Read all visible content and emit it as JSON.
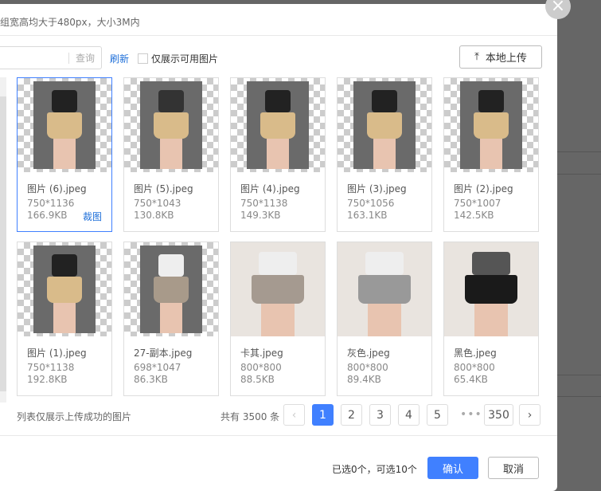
{
  "header": {
    "hint": "组宽高均大于480px，大小3M内"
  },
  "toolbar": {
    "search_button": "查询",
    "refresh": "刷新",
    "only_available": "仅展示可用图片",
    "upload": "本地上传"
  },
  "images": [
    {
      "name": "图片 (6).jpeg",
      "dim": "750*1136",
      "size": "166.9KB",
      "crop": "裁图",
      "selected": true,
      "top": "#222",
      "short": "#d9bb8a",
      "full": false
    },
    {
      "name": "图片 (5).jpeg",
      "dim": "750*1043",
      "size": "130.8KB",
      "top": "#333",
      "short": "#d9bb8a",
      "full": false
    },
    {
      "name": "图片 (4).jpeg",
      "dim": "750*1138",
      "size": "149.3KB",
      "top": "#222",
      "short": "#d9bb8a",
      "full": false
    },
    {
      "name": "图片 (3).jpeg",
      "dim": "750*1056",
      "size": "163.1KB",
      "top": "#222",
      "short": "#d9bb8a",
      "full": false
    },
    {
      "name": "图片 (2).jpeg",
      "dim": "750*1007",
      "size": "142.5KB",
      "top": "#222",
      "short": "#d9bb8a",
      "full": false
    },
    {
      "name": "图片 (1).jpeg",
      "dim": "750*1138",
      "size": "192.8KB",
      "top": "#222",
      "short": "#d9bb8a",
      "full": false
    },
    {
      "name": "27-副本.jpeg",
      "dim": "698*1047",
      "size": "86.3KB",
      "top": "#eee",
      "short": "#a89a8a",
      "full": false
    },
    {
      "name": "卡其.jpeg",
      "dim": "800*800",
      "size": "88.5KB",
      "top": "#eee",
      "short": "#a59a90",
      "full": true
    },
    {
      "name": "灰色.jpeg",
      "dim": "800*800",
      "size": "89.4KB",
      "top": "#eee",
      "short": "#999",
      "full": true
    },
    {
      "name": "黑色.jpeg",
      "dim": "800*800",
      "size": "65.4KB",
      "top": "#555",
      "short": "#1a1a1a",
      "full": true
    }
  ],
  "footer": {
    "note": "列表仅展示上传成功的图片",
    "total": "共有 3500 条",
    "pages": [
      "1",
      "2",
      "3",
      "4",
      "5",
      "350"
    ],
    "ellipsis": "•••",
    "selected_count": "已选0个，可选10个",
    "confirm": "确认",
    "cancel": "取消"
  },
  "colors": {
    "accent": "#4080ff",
    "link": "#1e6fd9"
  }
}
